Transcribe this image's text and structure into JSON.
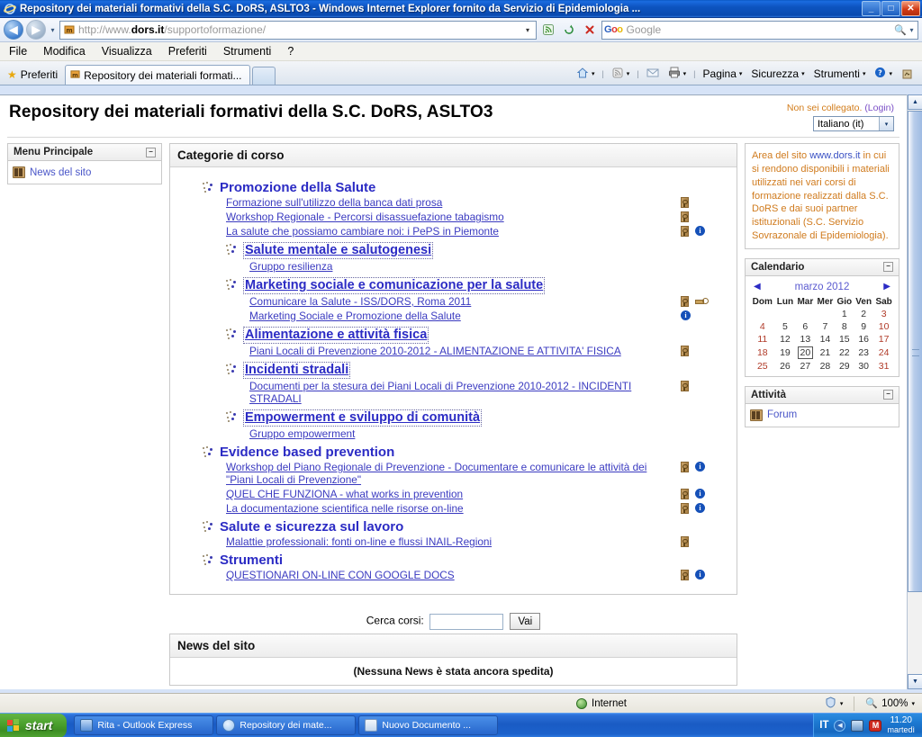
{
  "window": {
    "title": "Repository dei materiali formativi della S.C. DoRS, ASLTO3 - Windows Internet Explorer fornito da Servizio di Epidemiologia ...",
    "minimize_label": "_",
    "maximize_label": "□",
    "close_label": "✕"
  },
  "address_bar": {
    "back_label": "◀",
    "forward_label": "▶",
    "history_caret": "▾",
    "url_protocol": "http://www.",
    "url_domain": "dors.it",
    "url_path": "/supportoformazione/",
    "url_dropdown": "▾",
    "rss_label": "☰",
    "refresh_label": "↻",
    "stop_label": "✕",
    "search_engine": "Google",
    "search_placeholder": "Google",
    "search_button": "⚲"
  },
  "menu_bar": {
    "items": [
      "File",
      "Modifica",
      "Visualizza",
      "Preferiti",
      "Strumenti",
      "?"
    ]
  },
  "tab_bar": {
    "favorites_label": "Preferiti",
    "active_tab": "Repository dei materiali formati...",
    "new_tab_label": "",
    "commands": [
      {
        "label": "",
        "icon": "home-icon",
        "caret": "▾"
      },
      {
        "label": "",
        "icon": "feeds-icon",
        "caret": "▾"
      },
      {
        "label": "",
        "icon": "mail-icon",
        "caret": ""
      },
      {
        "label": "",
        "icon": "print-icon",
        "caret": "▾"
      },
      {
        "label": "Pagina",
        "icon": "",
        "caret": "▾"
      },
      {
        "label": "Sicurezza",
        "icon": "",
        "caret": "▾"
      },
      {
        "label": "Strumenti",
        "icon": "",
        "caret": "▾"
      },
      {
        "label": "",
        "icon": "help-icon",
        "caret": "▾"
      }
    ]
  },
  "page": {
    "site_title": "Repository dei materiali formativi della S.C. DoRS, ASLTO3",
    "login_notice": "Non sei collegato. ",
    "login_link": "(Login)",
    "language_selected": "Italiano (it)",
    "language_caret": "▾"
  },
  "left_block": {
    "heading": "Menu Principale",
    "minimize": "−",
    "items": [
      {
        "label": "News del sito",
        "icon": "forum-icon"
      }
    ]
  },
  "center": {
    "categories_panel_title": "Categorie di corso",
    "search_label": "Cerca corsi:",
    "search_value": "",
    "search_button": "Vai",
    "news_panel_title": "News del sito",
    "news_empty": "(Nessuna News è stata ancora spedita)",
    "categories": [
      {
        "name": "Promozione della Salute",
        "level": 1,
        "courses": [
          {
            "name": "Formazione sull'utilizzo della banca dati prosa",
            "key": true,
            "info": false,
            "guest": false,
            "indent": 1
          },
          {
            "name": "Workshop Regionale - Percorsi disassuefazione tabagismo",
            "key": true,
            "info": false,
            "guest": false,
            "indent": 1
          },
          {
            "name": "La salute che possiamo cambiare noi: i PePS in Piemonte",
            "key": true,
            "info": true,
            "guest": false,
            "indent": 1
          }
        ]
      },
      {
        "name": "Salute mentale e salutogenesi",
        "level": 2,
        "courses": [
          {
            "name": "Gruppo resilienza",
            "key": false,
            "info": false,
            "guest": false,
            "indent": 2
          }
        ]
      },
      {
        "name": "Marketing sociale e comunicazione per la salute",
        "level": 2,
        "courses": [
          {
            "name": "Comunicare la Salute - ISS/DORS, Roma 2011",
            "key": true,
            "info": false,
            "guest": true,
            "indent": 2
          },
          {
            "name": "Marketing Sociale e Promozione della Salute",
            "key": false,
            "info": true,
            "guest": false,
            "indent": 2
          }
        ]
      },
      {
        "name": "Alimentazione e attività fisica",
        "level": 2,
        "courses": [
          {
            "name": "Piani Locali di Prevenzione 2010-2012 - ALIMENTAZIONE E ATTIVITA' FISICA",
            "key": true,
            "info": false,
            "guest": false,
            "indent": 2
          }
        ]
      },
      {
        "name": "Incidenti stradali",
        "level": 2,
        "courses": [
          {
            "name": "Documenti per la stesura dei Piani Locali di Prevenzione 2010-2012 - INCIDENTI STRADALI",
            "key": true,
            "info": false,
            "guest": false,
            "indent": 2
          }
        ]
      },
      {
        "name": "Empowerment e sviluppo di comunità",
        "level": 2,
        "courses": [
          {
            "name": "Gruppo empowerment",
            "key": false,
            "info": false,
            "guest": false,
            "indent": 2
          }
        ]
      },
      {
        "name": "Evidence based prevention",
        "level": 1,
        "courses": [
          {
            "name": "Workshop del Piano Regionale di Prevenzione - Documentare e comunicare le attività dei \"Piani Locali di Prevenzione\"",
            "key": true,
            "info": true,
            "guest": false,
            "indent": 1
          },
          {
            "name": "QUEL CHE FUNZIONA - what works in prevention",
            "key": true,
            "info": true,
            "guest": false,
            "indent": 1
          },
          {
            "name": "La documentazione scientifica nelle risorse on-line",
            "key": true,
            "info": true,
            "guest": false,
            "indent": 1
          }
        ]
      },
      {
        "name": "Salute e sicurezza sul lavoro",
        "level": 1,
        "courses": [
          {
            "name": "Malattie professionali: fonti on-line e flussi INAIL-Regioni",
            "key": true,
            "info": false,
            "guest": false,
            "indent": 1
          }
        ]
      },
      {
        "name": "Strumenti",
        "level": 1,
        "courses": [
          {
            "name": "QUESTIONARI ON-LINE CON GOOGLE DOCS",
            "key": true,
            "info": true,
            "guest": false,
            "indent": 1
          }
        ]
      }
    ]
  },
  "right_col": {
    "info_text_a": "Area del sito ",
    "info_link": "www.dors.it",
    "info_text_b": " in cui si rendono disponibili i materiali utilizzati nei vari corsi di formazione realizzati dalla S.C. DoRS e dai suoi partner istituzionali (S.C. Servizio Sovrazonale di Epidemiologia).",
    "calendar": {
      "heading": "Calendario",
      "minimize": "−",
      "prev": "◀",
      "next": "▶",
      "month_label": "marzo 2012",
      "weekdays": [
        "Dom",
        "Lun",
        "Mar",
        "Mer",
        "Gio",
        "Ven",
        "Sab"
      ],
      "weeks": [
        [
          "",
          "",
          "",
          "",
          "1",
          "2",
          "3"
        ],
        [
          "4",
          "5",
          "6",
          "7",
          "8",
          "9",
          "10"
        ],
        [
          "11",
          "12",
          "13",
          "14",
          "15",
          "16",
          "17"
        ],
        [
          "18",
          "19",
          "20",
          "21",
          "22",
          "23",
          "24"
        ],
        [
          "25",
          "26",
          "27",
          "28",
          "29",
          "30",
          "31"
        ]
      ],
      "today": "20"
    },
    "activities": {
      "heading": "Attività",
      "minimize": "−",
      "items": [
        {
          "label": "Forum",
          "icon": "forum-icon"
        }
      ]
    }
  },
  "scrollbar": {
    "up": "▲",
    "down": "▼"
  },
  "status_bar": {
    "zone": "Internet",
    "protected_icon": "shield-icon",
    "protected_caret": "▾",
    "zoom_level": "100%",
    "zoom_caret": "▾"
  },
  "taskbar": {
    "start_label": "start",
    "items": [
      {
        "label": "Rita - Outlook Express",
        "icon": "outlook-icon"
      },
      {
        "label": "Repository dei mate...",
        "icon": "ie-icon"
      },
      {
        "label": "Nuovo Documento ...",
        "icon": "document-icon"
      }
    ],
    "tray": {
      "language": "IT",
      "arrow": "◀",
      "network_icon": "network-icon",
      "antivirus_icon": "mcafee-icon",
      "time": "11.20",
      "day": "martedì"
    }
  },
  "colors": {
    "title_blue": "#0a54c0",
    "link_blue": "#3a3ac0",
    "category_blue": "#2b2bc4",
    "orange_text": "#d07b1e",
    "weekend_red": "#b03a28",
    "info_badge": "#1550b8"
  }
}
